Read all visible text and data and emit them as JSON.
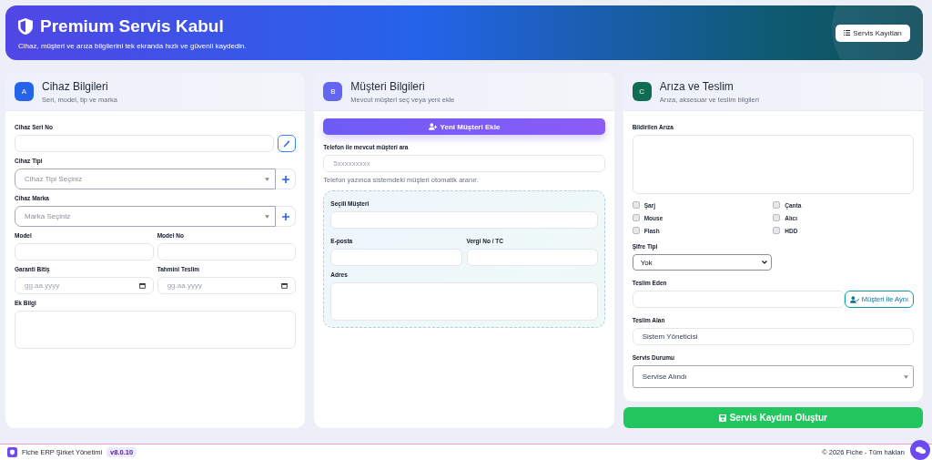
{
  "header": {
    "title": "Premium Servis Kabul",
    "subtitle": "Cihaz, müşteri ve arıza bilgilerini tek ekranda hızlı ve güvenli kaydedin.",
    "button": "Servis Kayıtları"
  },
  "device": {
    "badge": "A",
    "title": "Cihaz Bilgileri",
    "subtitle": "Seri, model, tip ve marka",
    "serial": {
      "label": "Cihaz Seri No"
    },
    "type": {
      "label": "Cihaz Tipi",
      "placeholder": "Cihaz Tipi Seçiniz"
    },
    "brand": {
      "label": "Cihaz Marka",
      "placeholder": "Marka Seçiniz"
    },
    "model": {
      "label": "Model"
    },
    "model_no": {
      "label": "Model No"
    },
    "warranty": {
      "label": "Garanti Bitiş",
      "placeholder": "gg.aa.yyyy"
    },
    "delivery": {
      "label": "Tahmini Teslim",
      "placeholder": "gg.aa.yyyy"
    },
    "extra": {
      "label": "Ek Bilgi"
    }
  },
  "customer": {
    "badge": "B",
    "title": "Müşteri Bilgileri",
    "subtitle": "Mevcut müşteri seç veya yeni ekle",
    "add_button": "Yeni Müşteri Ekle",
    "phone": {
      "label": "Telefon ile mevcut müşteri ara",
      "placeholder": "5xxxxxxxxx",
      "hint": "Telefon yazınca sistemdeki müşteri otomatik aranır."
    },
    "selected": {
      "label": "Seçili Müşteri"
    },
    "email": {
      "label": "E-posta"
    },
    "tax": {
      "label": "Vergi No / TC"
    },
    "address": {
      "label": "Adres"
    }
  },
  "fault": {
    "badge": "C",
    "title": "Arıza ve Teslim",
    "subtitle": "Arıza, aksesuar ve teslim bilgileri",
    "reported": {
      "label": "Bildirilen Arıza"
    },
    "accessories": [
      {
        "label": "Şarj",
        "checked": false
      },
      {
        "label": "Çanta",
        "checked": false
      },
      {
        "label": "Mouse",
        "checked": false
      },
      {
        "label": "Alıcı",
        "checked": false
      },
      {
        "label": "Flash",
        "checked": false
      },
      {
        "label": "HDD",
        "checked": false
      }
    ],
    "password": {
      "label": "Şifre Tipi",
      "value": "Yok"
    },
    "delivered_by": {
      "label": "Teslim Eden",
      "button": "Müşteri İle Aynı"
    },
    "received_by": {
      "label": "Teslim Alan",
      "value": "Sistem Yöneticisi"
    },
    "status": {
      "label": "Servis Durumu",
      "value": "Servise Alındı"
    }
  },
  "submit": "Servis Kaydını Oluştur",
  "footer": {
    "app": "Fiche ERP Şirket Yönetimi",
    "version": "v8.0.10",
    "copyright": "© 2026 Fiche - Tüm hakları"
  }
}
